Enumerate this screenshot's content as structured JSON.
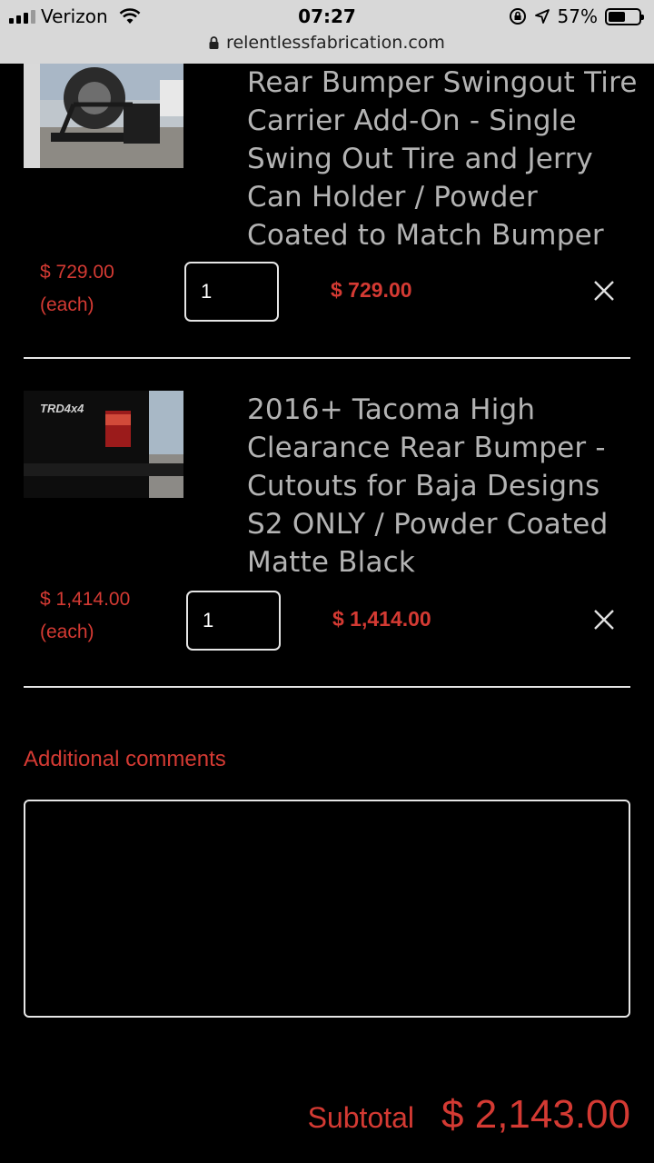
{
  "status_bar": {
    "carrier": "Verizon",
    "time": "07:27",
    "battery_percent": "57%",
    "battery_level": 0.57,
    "url": "relentlessfabrication.com"
  },
  "cart": {
    "items": [
      {
        "title": "Rear Bumper Swingout Tire Carrier Add-On - Single Swing Out Tire and Jerry Can Holder / Powder Coated to Match Bumper",
        "unit_price": "$ 729.00",
        "each_label": "(each)",
        "quantity": "1",
        "line_total": "$ 729.00",
        "image": "swingout-tire-carrier-photo"
      },
      {
        "title": "2016+ Tacoma High Clearance Rear Bumper - Cutouts for Baja Designs S2 ONLY / Powder Coated Matte Black",
        "unit_price": "$ 1,414.00",
        "each_label": "(each)",
        "quantity": "1",
        "line_total": "$ 1,414.00",
        "image": "tacoma-rear-bumper-photo"
      }
    ],
    "comments_label": "Additional comments",
    "comments_value": "",
    "subtotal_label": "Subtotal",
    "subtotal_value": "$ 2,143.00"
  },
  "colors": {
    "accent_red": "#d43a33",
    "text_gray": "#b3b3b3",
    "background": "#000000",
    "status_bar": "#d8d8d8"
  }
}
